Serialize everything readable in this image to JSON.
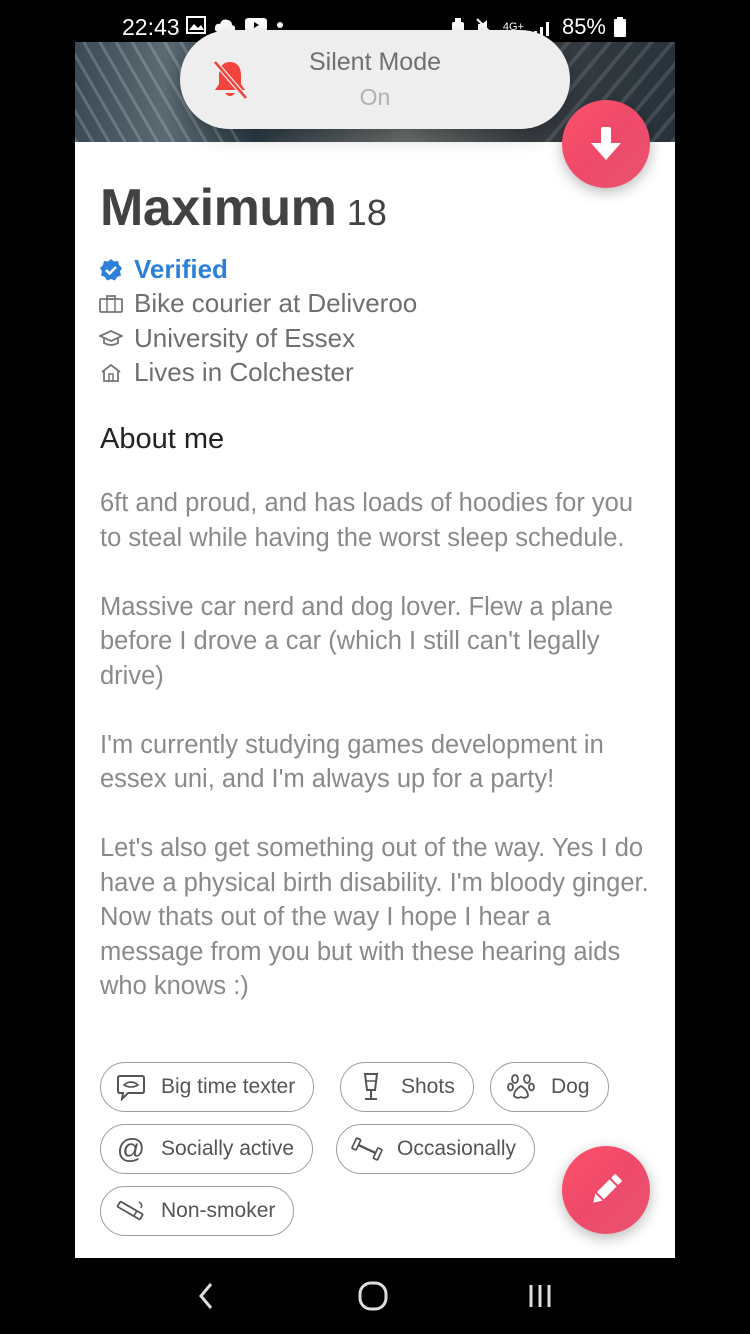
{
  "status_bar": {
    "time": "22:43",
    "battery": "85%",
    "network": "4G+"
  },
  "toast": {
    "title": "Silent Mode",
    "subtitle": "On",
    "icon": "bell-slash-icon"
  },
  "profile": {
    "name": "Maximum",
    "age": "18",
    "verified_label": "Verified",
    "job": "Bike courier at Deliveroo",
    "school": "University of Essex",
    "lives": "Lives in Colchester"
  },
  "about": {
    "heading": "About me",
    "paragraphs": [
      "6ft and proud, and has loads of hoodies for you to steal while having the worst sleep schedule.",
      "Massive car nerd and dog lover. Flew a plane before I drove a car (which I still can't legally drive)",
      "I'm currently studying games development in essex uni, and I'm always up for a party!",
      "Let's also get something out of the way. Yes I do have a physical birth disability. I'm bloody ginger. Now thats out of the way I hope I hear a message from you but with these hearing aids who knows :)"
    ]
  },
  "chips": [
    {
      "label": "Big time texter",
      "icon": "chat-bubble-icon"
    },
    {
      "label": "Shots",
      "icon": "shot-glass-icon"
    },
    {
      "label": "Dog",
      "icon": "paw-icon"
    },
    {
      "label": "Socially active",
      "icon": "at-sign-icon"
    },
    {
      "label": "Occasionally",
      "icon": "dumbbell-icon"
    },
    {
      "label": "Non-smoker",
      "icon": "cigarette-icon"
    }
  ],
  "colors": {
    "accent_gradient_start": "#fd5068",
    "accent_gradient_end": "#e8546e",
    "verified_blue": "#2e7fd8"
  }
}
